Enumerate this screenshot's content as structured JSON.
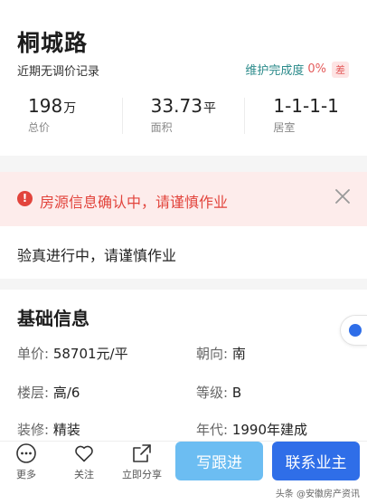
{
  "header": {
    "title": "桐城路",
    "subtitle": "近期无调价记录",
    "maintenance_label": "维护完成度",
    "maintenance_pct": "0%",
    "maintenance_badge": "差"
  },
  "stats": [
    {
      "value": "198",
      "unit": "万",
      "label": "总价"
    },
    {
      "value": "33.73",
      "unit": "平",
      "label": "面积"
    },
    {
      "value": "1-1-1-1",
      "unit": "",
      "label": "居室"
    }
  ],
  "alert": {
    "icon": "alert-circle-icon",
    "text": "房源信息确认中，请谨慎作业",
    "color": "#e2443c"
  },
  "verify": {
    "text": "验真进行中，请谨慎作业"
  },
  "basic_info": {
    "title": "基础信息",
    "unit_price_label": "单价:",
    "unit_price_value": "58701元/平",
    "orientation_label": "朝向:",
    "orientation_value": "南",
    "floor_label": "楼层:",
    "floor_value": "高/6",
    "grade_label": "等级:",
    "grade_value": "B",
    "decor_label": "装修:",
    "decor_value": "精装",
    "year_label": "年代:",
    "year_value": "1990年建成"
  },
  "bottom_bar": {
    "more_label": "更多",
    "follow_label": "关注",
    "share_label": "立即分享",
    "write_follow_label": "写跟进",
    "contact_owner_label": "联系业主"
  },
  "watermark": "头条 @安徽房产资讯",
  "colors": {
    "primary": "#2f6ee8",
    "secondary_button": "#6cbdf2",
    "alert_bg": "#fdeceb"
  }
}
